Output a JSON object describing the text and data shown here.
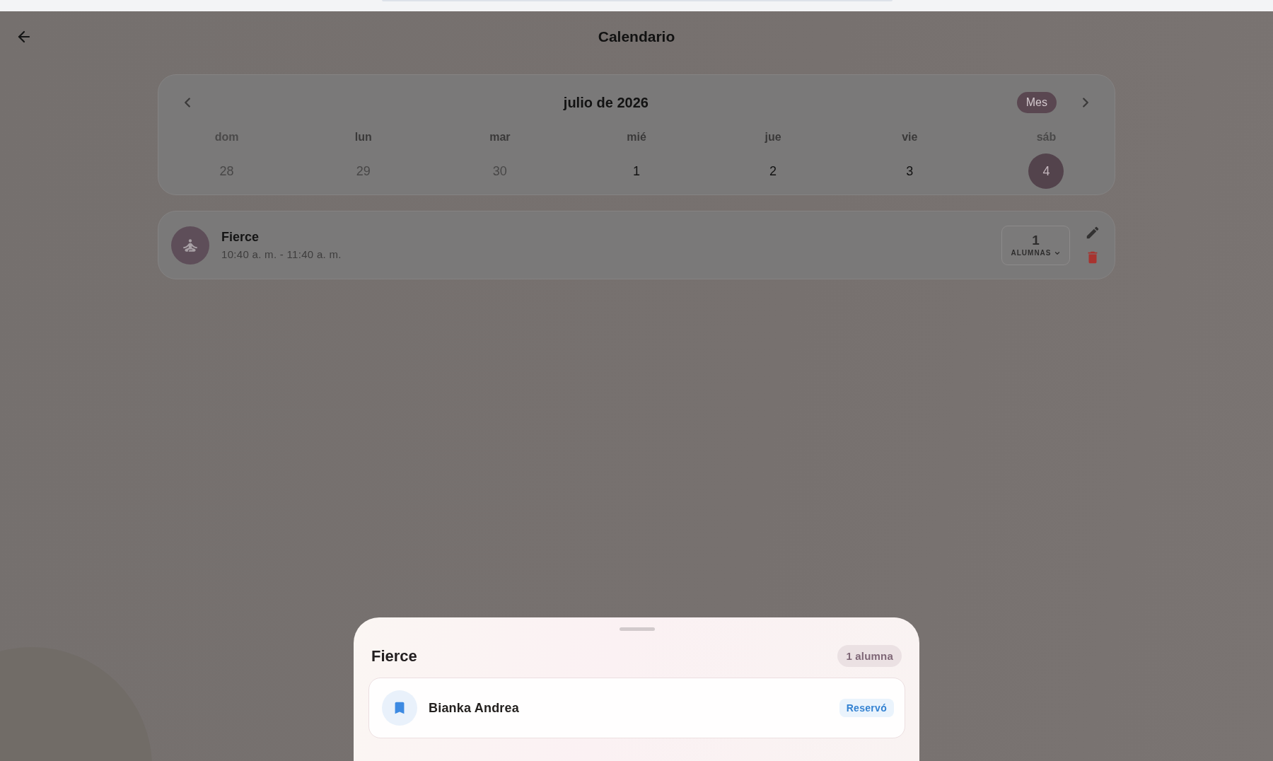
{
  "header": {
    "title": "Calendario"
  },
  "calendar": {
    "month_title": "julio de 2026",
    "view_button": "Mes",
    "weekdays": [
      {
        "label": "dom",
        "weekend": true
      },
      {
        "label": "lun",
        "weekend": false
      },
      {
        "label": "mar",
        "weekend": false
      },
      {
        "label": "mié",
        "weekend": false
      },
      {
        "label": "jue",
        "weekend": false
      },
      {
        "label": "vie",
        "weekend": false
      },
      {
        "label": "sáb",
        "weekend": true
      }
    ],
    "days": [
      {
        "label": "28",
        "outside_month": true,
        "selected": false
      },
      {
        "label": "29",
        "outside_month": true,
        "selected": false
      },
      {
        "label": "30",
        "outside_month": true,
        "selected": false
      },
      {
        "label": "1",
        "outside_month": false,
        "selected": false
      },
      {
        "label": "2",
        "outside_month": false,
        "selected": false
      },
      {
        "label": "3",
        "outside_month": false,
        "selected": false
      },
      {
        "label": "4",
        "outside_month": false,
        "selected": true
      }
    ]
  },
  "classes": [
    {
      "title": "Fierce",
      "time": "10:40 a. m. - 11:40 a. m.",
      "count": "1",
      "count_label": "ALUMNAS"
    }
  ],
  "sheet": {
    "title": "Fierce",
    "count_badge": "1 alumna",
    "students": [
      {
        "name": "Bianka Andrea",
        "status": "Reservó"
      }
    ]
  }
}
